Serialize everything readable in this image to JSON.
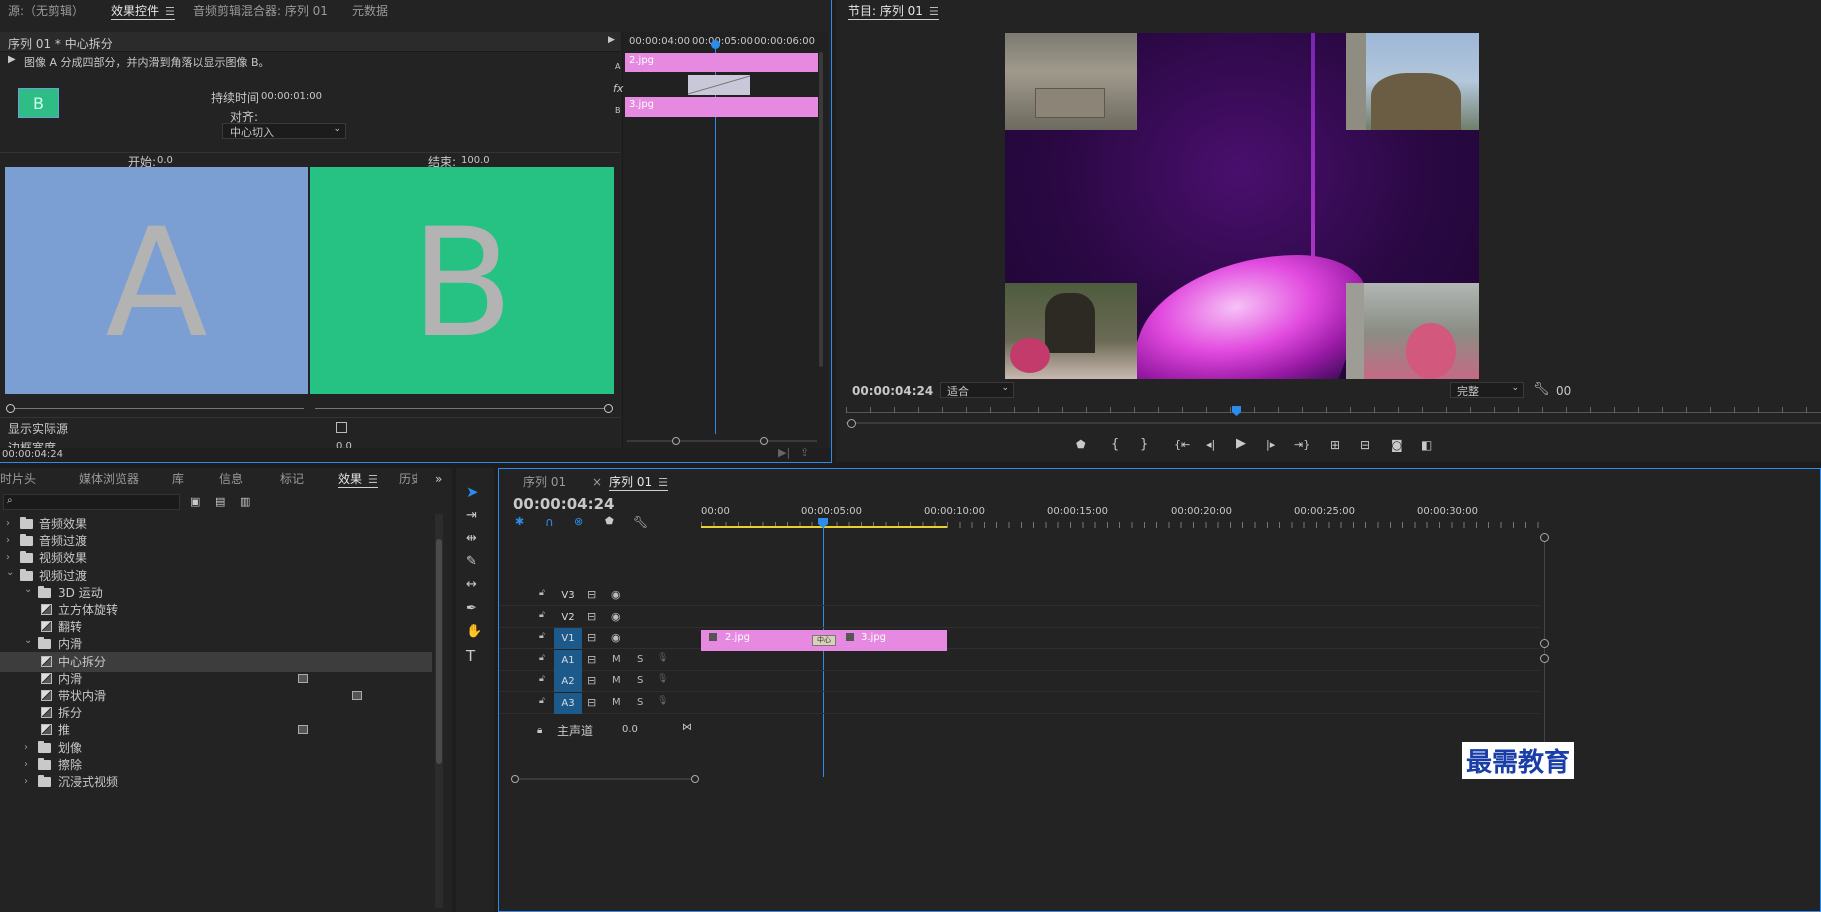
{
  "source_panel": {
    "tabs": [
      "源:（无剪辑）",
      "效果控件",
      "音频剪辑混合器: 序列 01",
      "元数据"
    ],
    "active_tab": "效果控件",
    "clip_path": "序列 01 * 中心拆分",
    "description": "图像 A 分成四部分，并内滑到角落以显示图像 B。",
    "thumb_letter": "B",
    "duration_label": "持续时间",
    "duration_value": "00:00:01:00",
    "align_label": "对齐:",
    "align_value": "中心切入",
    "start_label": "开始:",
    "start_value": "0.0",
    "end_label": "结束:",
    "end_value": "100.0",
    "preview_a": "A",
    "preview_b": "B",
    "show_actual_label": "显示实际源",
    "border_label": "边框宽度",
    "border_value": "0.0",
    "timecode": "00:00:04:24",
    "mini_ruler": [
      "00:00:04:00",
      "00:00:05:00",
      "00:00:06:00"
    ],
    "track_a_label": "A",
    "track_b_label": "B",
    "fx_label": "fx",
    "clip_a": "2.jpg",
    "clip_b": "3.jpg"
  },
  "program_monitor": {
    "title": "节目: 序列 01",
    "timecode": "00:00:04:24",
    "fit_value": "适合",
    "quality_value": "完整",
    "right_clip": "00",
    "colors": {
      "purple": "#3a0a55",
      "magenta": "#d22bd6"
    }
  },
  "project_panel": {
    "tabs": [
      "计时片头",
      "媒体浏览器",
      "库",
      "信息",
      "标记",
      "效果",
      "历史"
    ],
    "active_tab": "效果",
    "search_placeholder": "",
    "tree": [
      {
        "label": "音频效果",
        "level": 0,
        "type": "folder",
        "expanded": false
      },
      {
        "label": "音频过渡",
        "level": 0,
        "type": "folder",
        "expanded": false
      },
      {
        "label": "视频效果",
        "level": 0,
        "type": "folder",
        "expanded": false
      },
      {
        "label": "视频过渡",
        "level": 0,
        "type": "folder",
        "expanded": true
      },
      {
        "label": "3D 运动",
        "level": 1,
        "type": "folder",
        "expanded": true
      },
      {
        "label": "立方体旋转",
        "level": 2,
        "type": "effect"
      },
      {
        "label": "翻转",
        "level": 2,
        "type": "effect"
      },
      {
        "label": "内滑",
        "level": 1,
        "type": "folder",
        "expanded": true
      },
      {
        "label": "中心拆分",
        "level": 2,
        "type": "effect",
        "selected": true
      },
      {
        "label": "内滑",
        "level": 2,
        "type": "effect",
        "badge": true
      },
      {
        "label": "带状内滑",
        "level": 2,
        "type": "effect",
        "badge2": true
      },
      {
        "label": "拆分",
        "level": 2,
        "type": "effect"
      },
      {
        "label": "推",
        "level": 2,
        "type": "effect",
        "badge": true
      },
      {
        "label": "划像",
        "level": 1,
        "type": "folder",
        "expanded": false
      },
      {
        "label": "擦除",
        "level": 1,
        "type": "folder",
        "expanded": false
      },
      {
        "label": "沉浸式视频",
        "level": 1,
        "type": "folder",
        "expanded": false
      }
    ]
  },
  "timeline": {
    "tabs": [
      "序列 01",
      "序列 01"
    ],
    "active_tab_index": 1,
    "timecode": "00:00:04:24",
    "ruler": [
      "00:00",
      "00:00:05:00",
      "00:00:10:00",
      "00:00:15:00",
      "00:00:20:00",
      "00:00:25:00",
      "00:00:30:00"
    ],
    "tracks": [
      {
        "name": "V3",
        "kind": "video",
        "target": false
      },
      {
        "name": "V2",
        "kind": "video",
        "target": false
      },
      {
        "name": "V1",
        "kind": "video",
        "target": true
      },
      {
        "name": "A1",
        "kind": "audio",
        "target": true
      },
      {
        "name": "A2",
        "kind": "audio",
        "target": true
      },
      {
        "name": "A3",
        "kind": "audio",
        "target": true
      }
    ],
    "mute_label": "M",
    "solo_label": "S",
    "master_label": "主声道",
    "master_value": "0.0",
    "clip1": "2.jpg",
    "clip2": "3.jpg",
    "transition_label": "中心"
  },
  "watermark": "最需教育"
}
